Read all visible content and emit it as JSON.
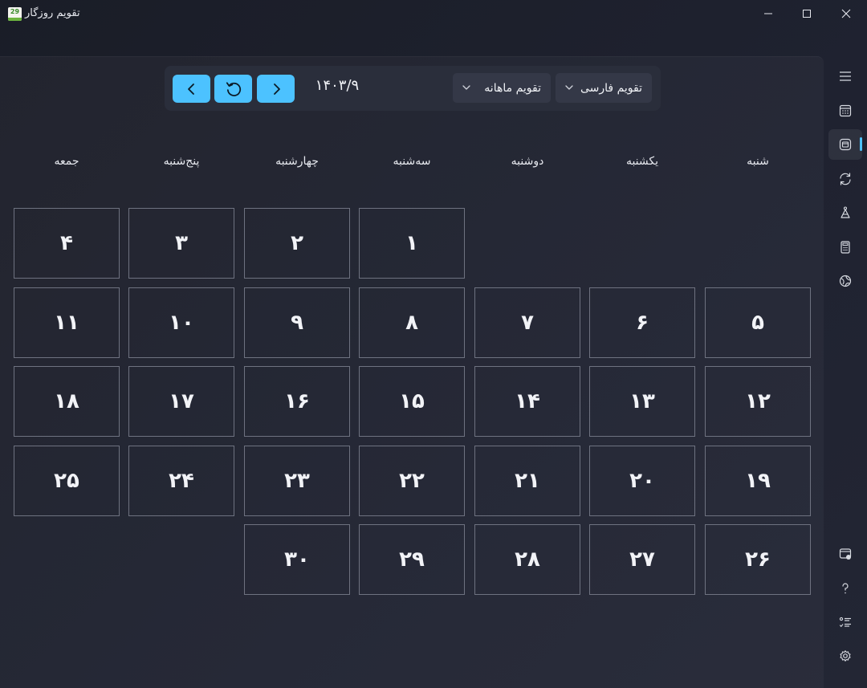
{
  "window": {
    "title": "تقویم روزگار",
    "icon_number": "29"
  },
  "toolbar": {
    "current_date": "۱۴۰۳/۹",
    "calendar_type": "تقویم فارسی",
    "view_mode": "تقویم ماهانه",
    "prev_icon": "chevron-left-icon",
    "today_icon": "refresh-icon",
    "next_icon": "chevron-right-icon"
  },
  "weekdays": [
    "شنبه",
    "یکشنبه",
    "دوشنبه",
    "سه‌شنبه",
    "چهارشنبه",
    "پنج‌شنبه",
    "جمعه"
  ],
  "days": [
    "۱",
    "۲",
    "۳",
    "۴",
    "۵",
    "۶",
    "۷",
    "۸",
    "۹",
    "۱۰",
    "۱۱",
    "۱۲",
    "۱۳",
    "۱۴",
    "۱۵",
    "۱۶",
    "۱۷",
    "۱۸",
    "۱۹",
    "۲۰",
    "۲۱",
    "۲۲",
    "۲۳",
    "۲۴",
    "۲۵",
    "۲۶",
    "۲۷",
    "۲۸",
    "۲۹",
    "۳۰"
  ],
  "sidebar": {
    "items": [
      {
        "icon": "menu-icon"
      },
      {
        "icon": "calendar-icon"
      },
      {
        "icon": "month-view-icon"
      },
      {
        "icon": "convert-icon"
      },
      {
        "icon": "prayer-icon"
      },
      {
        "icon": "calculator-icon"
      },
      {
        "icon": "globe-icon"
      },
      {
        "icon": "widget-icon"
      },
      {
        "icon": "help-icon"
      },
      {
        "icon": "events-list-icon"
      },
      {
        "icon": "settings-icon"
      }
    ]
  },
  "colors": {
    "accent": "#4cc2ff",
    "background": "#1c1f2a",
    "toolbar": "#2a2e3b",
    "cell_border": "#6e7280"
  }
}
